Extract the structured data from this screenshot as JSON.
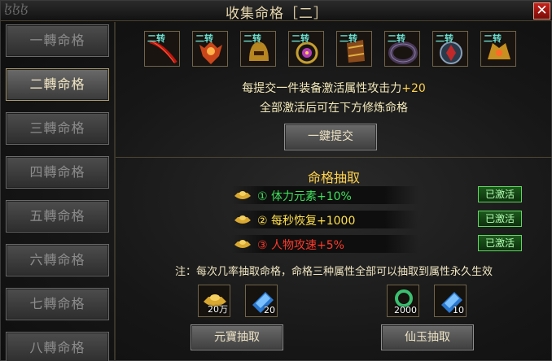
{
  "window": {
    "title": "收集命格［二］",
    "logo_text": "ɮɮɮ",
    "close_label": "✕"
  },
  "sidebar": {
    "items": [
      {
        "label": "一轉命格",
        "active": false
      },
      {
        "label": "二轉命格",
        "active": true
      },
      {
        "label": "三轉命格",
        "active": false
      },
      {
        "label": "四轉命格",
        "active": false
      },
      {
        "label": "五轉命格",
        "active": false
      },
      {
        "label": "六轉命格",
        "active": false
      },
      {
        "label": "七轉命格",
        "active": false
      },
      {
        "label": "八轉命格",
        "active": false
      }
    ]
  },
  "collect": {
    "items": [
      {
        "tag": "二转",
        "icon": "red-blade-icon",
        "color": "#b0140e"
      },
      {
        "tag": "二转",
        "icon": "phoenix-armor-icon",
        "color": "#d2571a"
      },
      {
        "tag": "二转",
        "icon": "gold-helmet-icon",
        "color": "#c59a2a"
      },
      {
        "tag": "二转",
        "icon": "gem-necklace-icon",
        "color": "#b43cb4"
      },
      {
        "tag": "二转",
        "icon": "bracer-icon",
        "color": "#a86a2a"
      },
      {
        "tag": "二转",
        "icon": "dark-ring-icon",
        "color": "#3a2a4a"
      },
      {
        "tag": "二转",
        "icon": "shield-belt-icon",
        "color": "#5a8ab0"
      },
      {
        "tag": "二转",
        "icon": "gold-boots-icon",
        "color": "#d2a030"
      }
    ],
    "info_line1_prefix": "每提交一件装备激活属性攻击力",
    "info_line1_value": "+20",
    "info_line2": "全部激活后可在下方修炼命格",
    "submit_label": "一鍵提交"
  },
  "draw": {
    "title": "命格抽取",
    "attrs": [
      {
        "text": "① 体力元素+10%",
        "color": "green",
        "status": "已激活"
      },
      {
        "text": "② 每秒恢复+1000",
        "color": "yellow",
        "status": "已激活"
      },
      {
        "text": "③ 人物攻速+5%",
        "color": "red",
        "status": "已激活"
      }
    ],
    "note": "注：每次几率抽取命格，命格三种属性全部可以抽取到属性永久生效",
    "left_costs": [
      {
        "icon": "gold-ingot-icon",
        "amount": "20万"
      },
      {
        "icon": "blue-jade-icon",
        "amount": "20"
      }
    ],
    "right_costs": [
      {
        "icon": "green-ring-icon",
        "amount": "2000"
      },
      {
        "icon": "blue-jade-icon",
        "amount": "10"
      }
    ],
    "left_button": "元寶抽取",
    "right_button": "仙玉抽取"
  }
}
